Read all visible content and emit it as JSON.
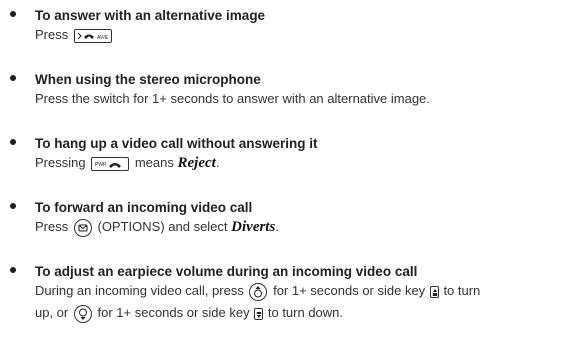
{
  "items": [
    {
      "title": "To answer with an alternative image",
      "body_pre": "Press",
      "key_icon": "alt-image-answer-key-icon"
    },
    {
      "title": "When using the stereo microphone",
      "body": "Press the switch for 1+ seconds to answer with an alternative image."
    },
    {
      "title": "To hang up a video call without answering it",
      "body_pre": "Pressing",
      "body_mid": "means",
      "body_em": "Reject",
      "body_post": ".",
      "key_icon": "power-end-key-icon"
    },
    {
      "title": "To forward an incoming video call",
      "body_pre": "Press",
      "body_mid": "(OPTIONS) and select",
      "body_em": "Diverts",
      "body_post": ".",
      "key_icon": "options-softkey-icon"
    },
    {
      "title": "To adjust an earpiece volume during an incoming video call",
      "line1_pre": "During an incoming video call, press",
      "line1_mid": "for 1+ seconds or side key",
      "line1_post": "to turn",
      "line2_pre": "up, or",
      "line2_mid": "for 1+ seconds or side key",
      "line2_post": "to turn down.",
      "icons": [
        "nav-up-key-icon",
        "side-key-up-icon",
        "nav-down-key-icon",
        "side-key-down-icon"
      ]
    }
  ]
}
